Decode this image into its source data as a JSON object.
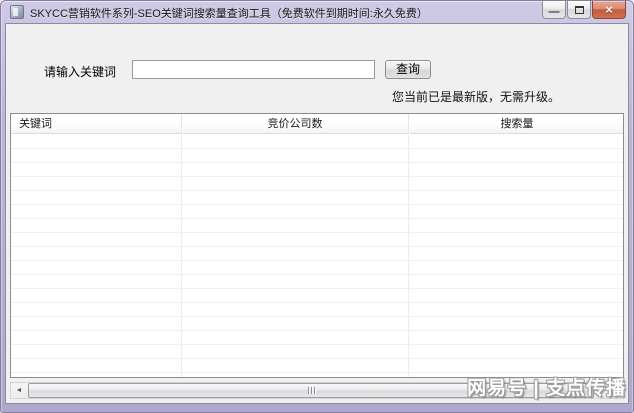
{
  "window": {
    "title": "SKYCC营销软件系列-SEO关键词搜索量查询工具（免费软件到期时间:永久免费）"
  },
  "icons": {
    "minimize": "—",
    "close": "×",
    "scroll_left": "◄",
    "scroll_right": "►"
  },
  "query": {
    "label": "请输入关键词",
    "input_value": "",
    "button_label": "查询"
  },
  "status": {
    "update_message": "您当前已是最新版，无需升级。"
  },
  "table": {
    "columns": [
      {
        "label": "关键词"
      },
      {
        "label": "竞价公司数"
      },
      {
        "label": "搜索量"
      }
    ],
    "rows": []
  },
  "watermark": {
    "text": "网易号 | 支点传播"
  },
  "colors": {
    "titlebar": "#c3bcdb",
    "client_bg": "#f0f0f0",
    "close_button": "#cf7052",
    "table_border": "#898c95"
  }
}
